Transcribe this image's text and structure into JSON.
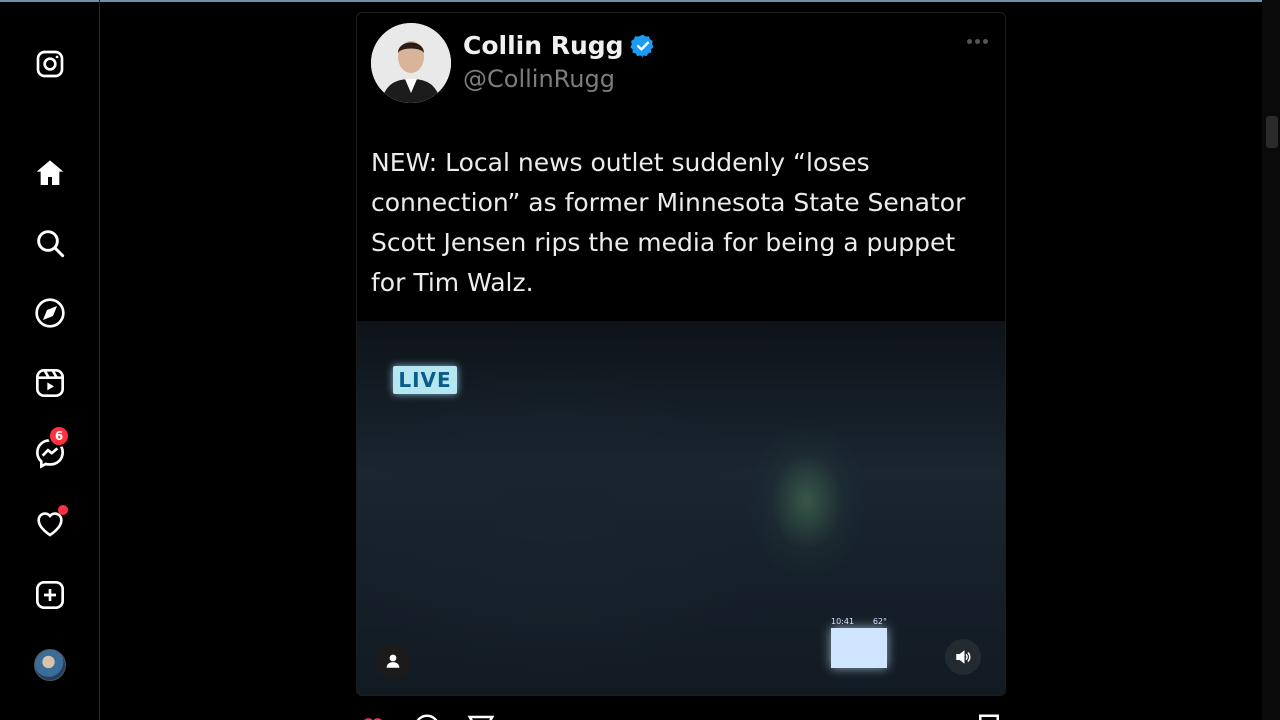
{
  "post": {
    "author_name": "Collin Rugg",
    "author_handle": "@CollinRugg",
    "text": "NEW: Local news outlet suddenly “loses connection” as former Minnesota State Senator Scott Jensen rips the media for being a puppet for Tim Walz.",
    "media": {
      "live_label": "LIVE",
      "ticker_time": "10:41",
      "ticker_temp": "62°"
    }
  },
  "sidebar": {
    "messages_badge": "6",
    "items": [
      "instagram-logo",
      "home",
      "search",
      "explore",
      "reels",
      "messages",
      "notifications",
      "create",
      "profile"
    ]
  },
  "colors": {
    "badge_red": "#ff3040",
    "verified_blue": "#1d9bf0",
    "live_badge_bg": "#b6e6f0"
  }
}
